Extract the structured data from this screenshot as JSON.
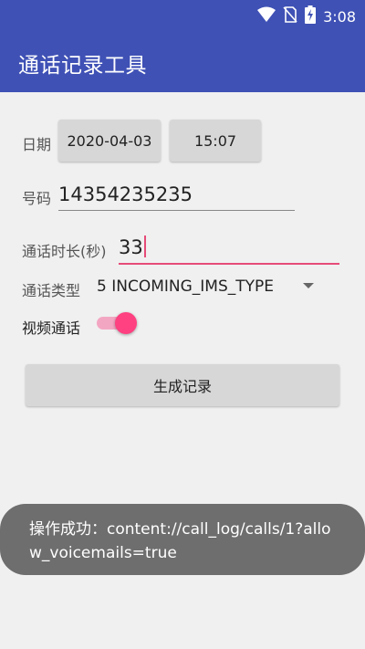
{
  "status_bar": {
    "time": "3:08",
    "icons": [
      "wifi-icon",
      "no-sim-icon",
      "battery-charging-icon"
    ]
  },
  "app_bar": {
    "title": "通话记录工具"
  },
  "form": {
    "date_label": "日期",
    "date_value": "2020-04-03",
    "time_value": "15:07",
    "number_label": "号码",
    "number_value": "14354235235",
    "duration_label": "通话时长(秒)",
    "duration_value": "33",
    "type_label": "通话类型",
    "type_value": "5 INCOMING_IMS_TYPE",
    "video_label": "视频通话",
    "video_enabled": true,
    "generate_button": "生成记录"
  },
  "toast": {
    "message": "操作成功：content://call_log/calls/1?allow_voicemails=true"
  },
  "colors": {
    "primary": "#3f51b5",
    "accent": "#ff4081",
    "background": "#f0f0f0"
  }
}
